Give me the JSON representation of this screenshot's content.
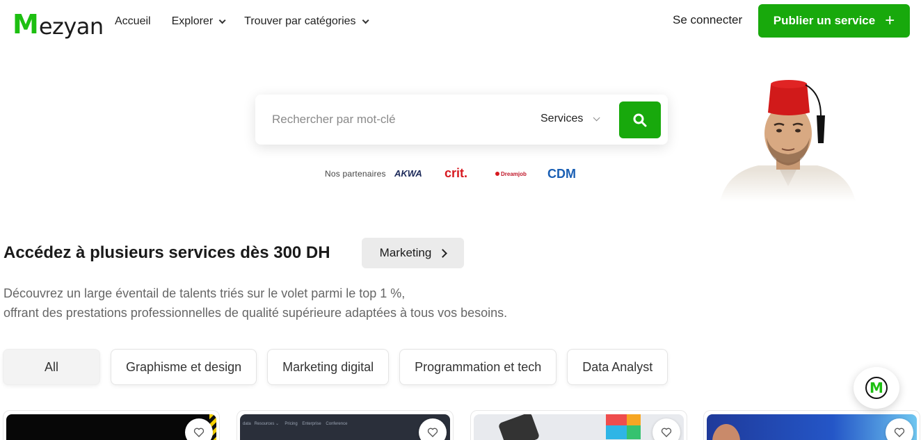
{
  "brand": {
    "logo_m": "M",
    "logo_rest": "ezyan",
    "accent": "#18a90c",
    "logo_green": "#1dbf11"
  },
  "nav": {
    "home": "Accueil",
    "explore": "Explorer",
    "categories": "Trouver par catégories"
  },
  "header": {
    "login": "Se connecter",
    "publish": "Publier un service",
    "publish_icon": "plus-icon"
  },
  "search": {
    "placeholder": "Rechercher par mot-clé",
    "type": "Services",
    "button_icon": "search-icon"
  },
  "partners": {
    "label": "Nos partenaires",
    "logos": [
      "AKWA",
      "crit.",
      "Dreamjob",
      "CDM"
    ]
  },
  "section": {
    "title": "Accédez à plusieurs services dès 300 DH",
    "category_chip": "Marketing",
    "desc_line1": "Découvrez un large éventail de talents triés sur le volet parmi le top 1 %,",
    "desc_line2": "offrant des prestations professionnelles de qualité supérieure adaptées à tous vos besoins."
  },
  "filters": [
    "All",
    "Graphisme et design",
    "Marketing digital",
    "Programmation et tech",
    "Data Analyst"
  ],
  "cards": [
    {
      "thumb_text": ""
    },
    {
      "thumb_text": "data   Resources ⌄     Pricing    Enterprise    Conference"
    },
    {
      "thumb_text": ""
    },
    {
      "thumb_text": ""
    }
  ],
  "chat": {
    "icon": "M"
  }
}
